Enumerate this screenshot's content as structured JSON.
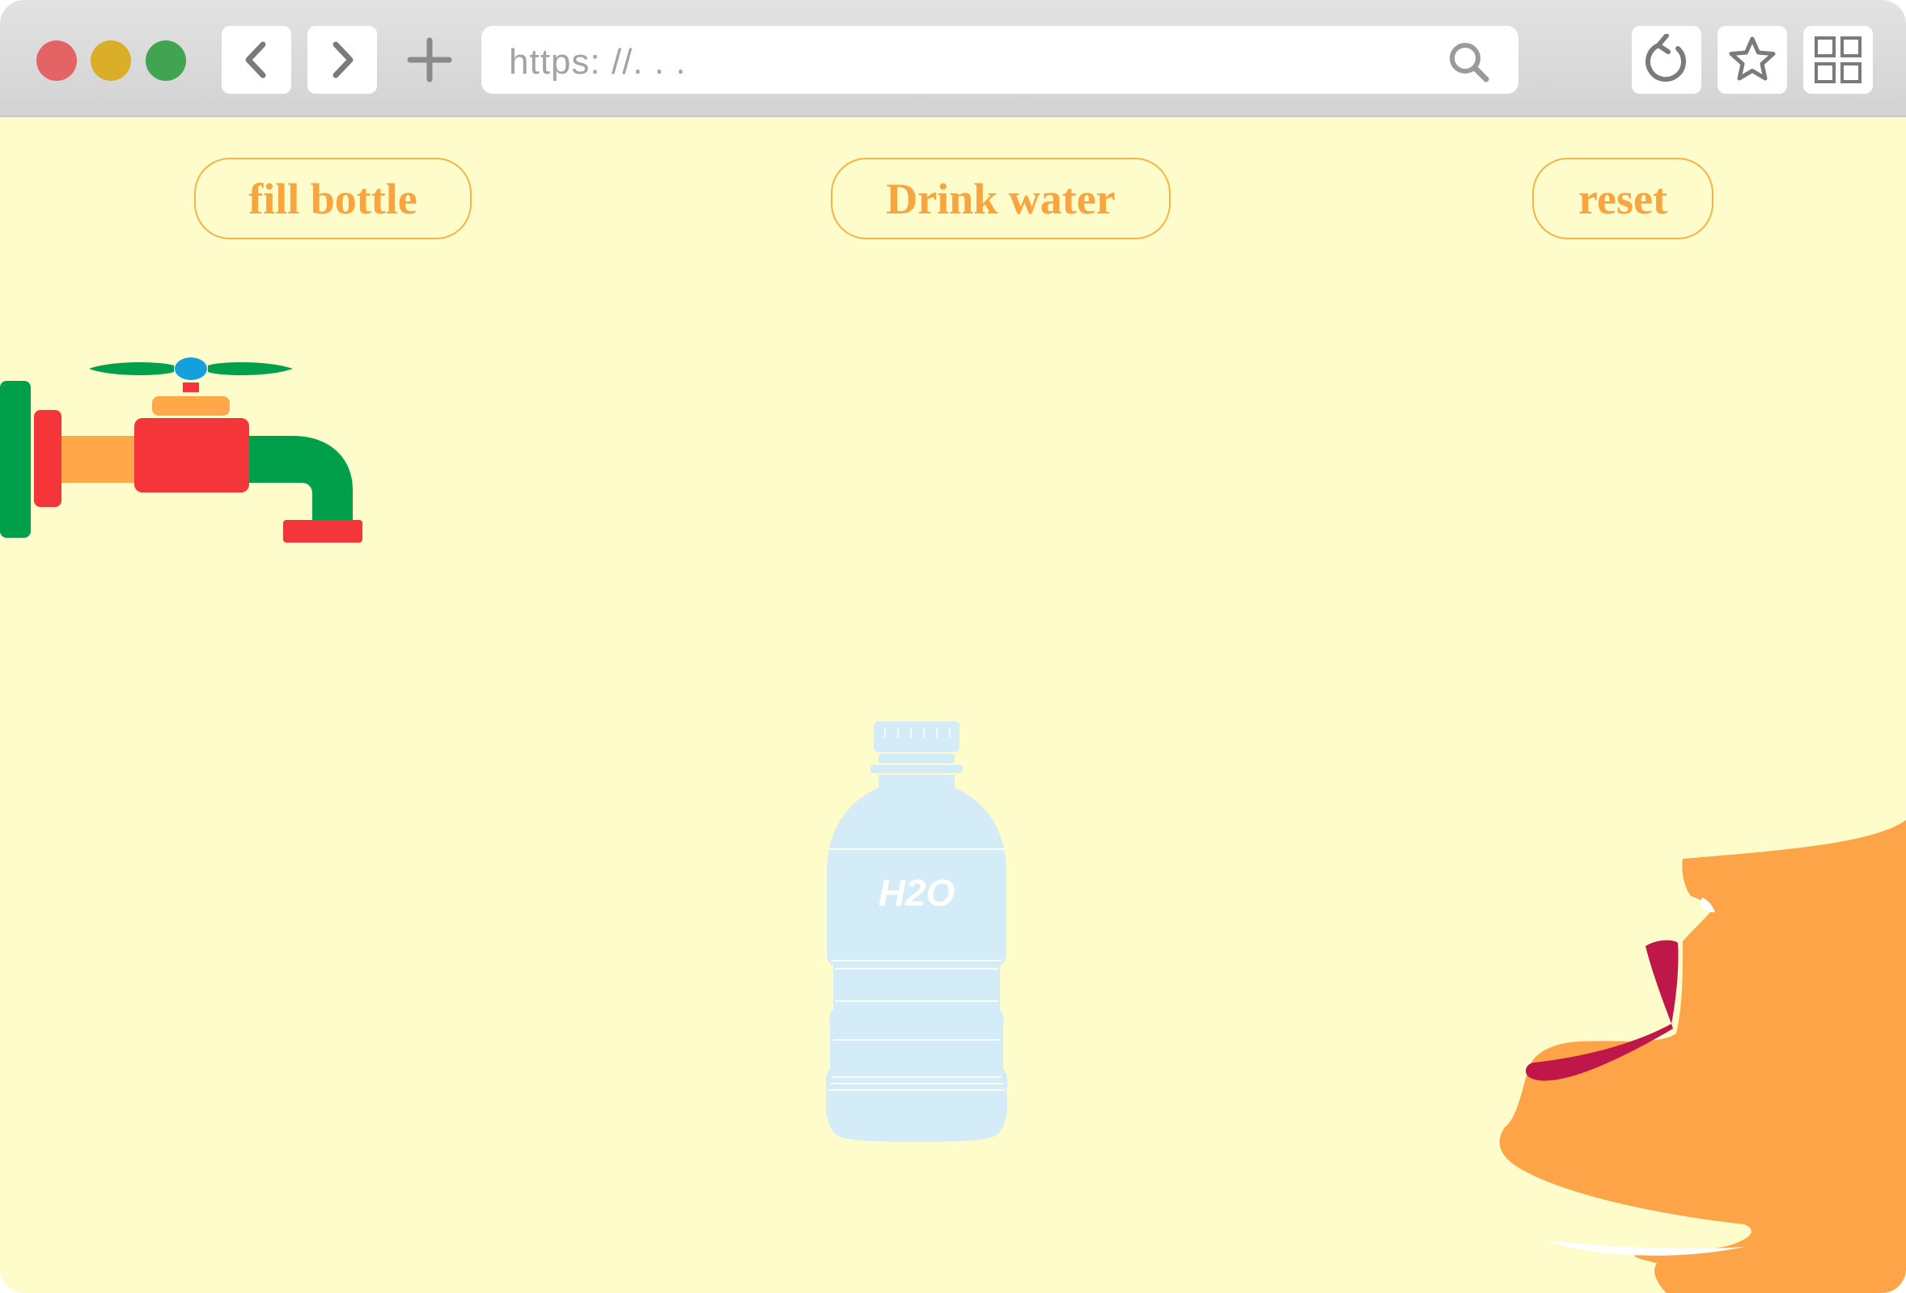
{
  "browser": {
    "url_placeholder": "https: //. . .",
    "traffic_light_colors": [
      "#e46465",
      "#dbae28",
      "#40a451"
    ],
    "icons": [
      "back-icon",
      "forward-icon",
      "new-tab-icon",
      "search-icon",
      "reload-icon",
      "bookmark-star-icon",
      "grid-icon"
    ]
  },
  "controls": {
    "fill_label": "fill bottle",
    "drink_label": "Drink water",
    "reset_label": "reset"
  },
  "bottle": {
    "label": "H2O",
    "water_level": 0
  },
  "colors": {
    "background": "#fffccb",
    "button_text": "#f9a53f",
    "tap_green": "#00a04b",
    "tap_red": "#f4363a",
    "tap_orange": "#fea84a",
    "tap_blue": "#15a0db",
    "bottle": "#d3ecf8",
    "face": "#fea448",
    "lips": "#c0174a"
  }
}
